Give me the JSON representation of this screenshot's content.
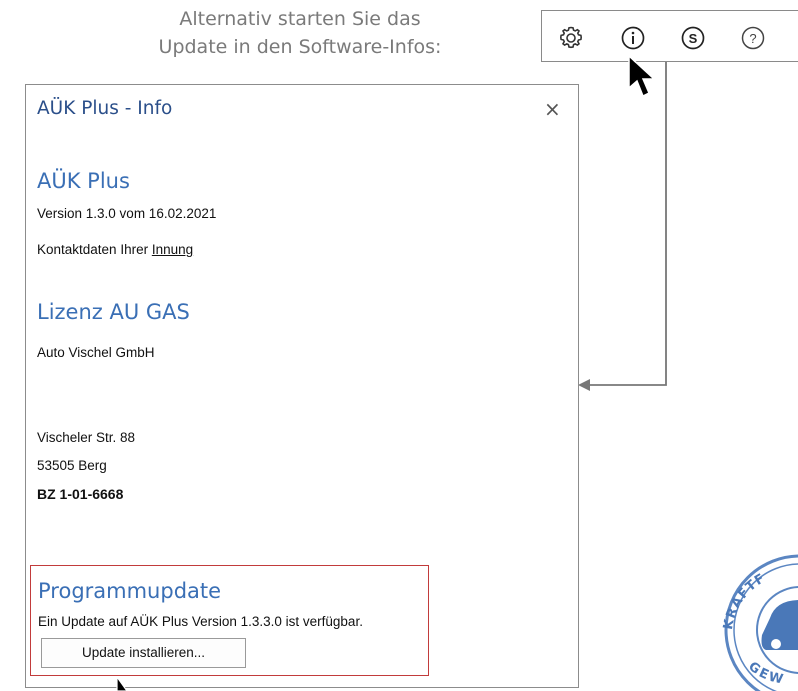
{
  "caption": {
    "line1": "Alternativ starten Sie das",
    "line2": "Update in den Software-Infos:"
  },
  "toolbar": {
    "icons": [
      "gear-icon",
      "info-icon",
      "s-circle-icon",
      "help-icon"
    ]
  },
  "dialog": {
    "title": "AÜK Plus - Info",
    "close": "×",
    "product": {
      "name": "AÜK Plus",
      "version": "Version 1.3.0 vom 16.02.2021",
      "contact_prefix": "Kontaktdaten Ihrer ",
      "contact_link": "Innung"
    },
    "license": {
      "heading": "Lizenz  AU  GAS",
      "company": "Auto Vischel GmbH",
      "street": "Vischeler Str. 88",
      "city": "53505 Berg",
      "bz": "BZ 1-01-6668"
    },
    "update": {
      "heading": "Programmupdate",
      "message": "Ein Update auf AÜK Plus Version 1.3.3.0 ist verfügbar.",
      "button": "Update installieren..."
    }
  },
  "seal": {
    "text_top": "KRAFTF",
    "text_bottom": "GEW"
  },
  "colors": {
    "accent_blue": "#3a6fb5",
    "title_blue": "#2b4f8a",
    "highlight_red": "#c23b3b",
    "seal_blue": "#4a78b8"
  }
}
